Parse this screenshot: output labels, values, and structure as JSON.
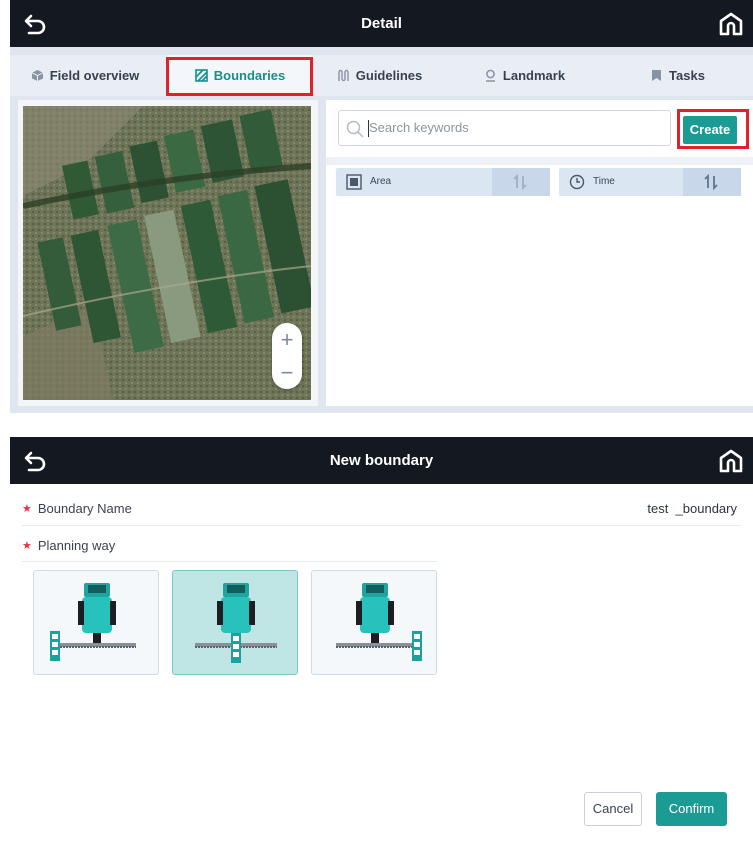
{
  "detail_screen": {
    "title": "Detail",
    "tabs": [
      {
        "label": "Field overview",
        "icon": "cube-icon",
        "active": false
      },
      {
        "label": "Boundaries",
        "icon": "boundary-hatch-icon",
        "active": true
      },
      {
        "label": "Guidelines",
        "icon": "guidelines-icon",
        "active": false
      },
      {
        "label": "Landmark",
        "icon": "pin-icon",
        "active": false
      },
      {
        "label": "Tasks",
        "icon": "flag-icon",
        "active": false
      }
    ],
    "map": {
      "zoom_in": "+",
      "zoom_out": "−"
    },
    "search": {
      "placeholder": "Search keywords"
    },
    "create_label": "Create",
    "sort": [
      {
        "label": "Area",
        "icon": "area-icon"
      },
      {
        "label": "Time",
        "icon": "clock-icon"
      }
    ]
  },
  "new_boundary_screen": {
    "title": "New boundary",
    "boundary_name_label": "Boundary Name",
    "boundary_name_value": "test  _boundary",
    "planning_way_label": "Planning way",
    "planning_options": [
      {
        "name": "left-implement",
        "selected": false
      },
      {
        "name": "center-implement",
        "selected": true
      },
      {
        "name": "right-implement",
        "selected": false
      }
    ],
    "cancel_label": "Cancel",
    "confirm_label": "Confirm"
  },
  "colors": {
    "accent": "#1a9c94",
    "titlebar": "#141820",
    "highlight_box": "#e0202a",
    "required_star": "#e63346"
  }
}
